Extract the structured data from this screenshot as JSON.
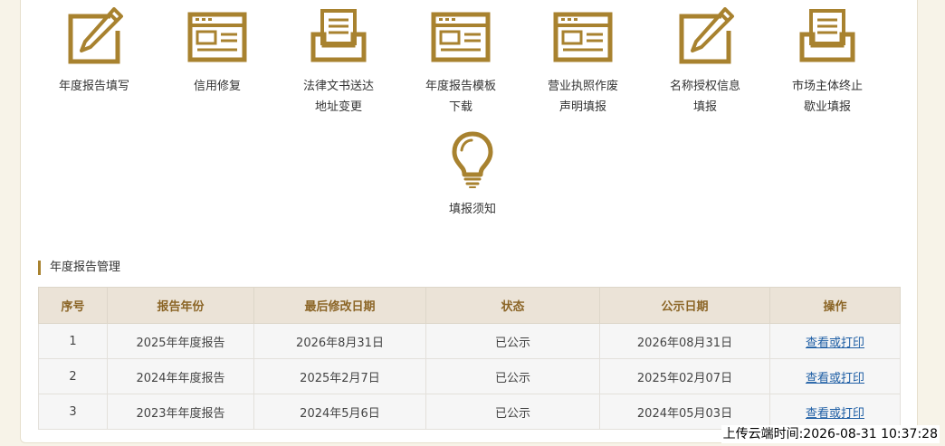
{
  "icons": [
    {
      "label_line1": "年度报告填写",
      "label_line2": "",
      "icon": "edit-form-icon"
    },
    {
      "label_line1": "信用修复",
      "label_line2": "",
      "icon": "form-window-icon"
    },
    {
      "label_line1": "法律文书送达",
      "label_line2": "地址变更",
      "icon": "inbox-tray-icon"
    },
    {
      "label_line1": "年度报告模板",
      "label_line2": "下载",
      "icon": "form-window-icon"
    },
    {
      "label_line1": "营业执照作废",
      "label_line2": "声明填报",
      "icon": "form-window-icon"
    },
    {
      "label_line1": "名称授权信息",
      "label_line2": "填报",
      "icon": "edit-form-icon"
    },
    {
      "label_line1": "市场主体终止",
      "label_line2": "歇业填报",
      "icon": "inbox-tray-icon"
    },
    {
      "label_line1": "填报须知",
      "label_line2": "",
      "icon": "lightbulb-icon"
    }
  ],
  "section": {
    "title": "年度报告管理"
  },
  "table": {
    "headers": {
      "index": "序号",
      "year": "报告年份",
      "modified": "最后修改日期",
      "status": "状态",
      "published": "公示日期",
      "action": "操作"
    },
    "rows": [
      {
        "index": "1",
        "year": "2025年年度报告",
        "modified": "2026年8月31日",
        "status": "已公示",
        "published": "2026年08月31日",
        "action": "查看或打印"
      },
      {
        "index": "2",
        "year": "2024年年度报告",
        "modified": "2025年2月7日",
        "status": "已公示",
        "published": "2025年02月07日",
        "action": "查看或打印"
      },
      {
        "index": "3",
        "year": "2023年年度报告",
        "modified": "2024年5月6日",
        "status": "已公示",
        "published": "2024年05月03日",
        "action": "查看或打印"
      }
    ]
  },
  "footer": {
    "timestamp": "上传云端时间:2026-08-31 10:37:28"
  },
  "colors": {
    "accent": "#a8822f",
    "header_bg": "#ebe3d7",
    "link": "#1f5fa5"
  }
}
